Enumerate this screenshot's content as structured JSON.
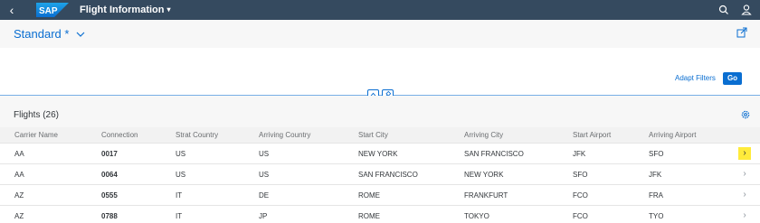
{
  "shell": {
    "logo_text": "SAP",
    "title": "Flight Information",
    "title_caret": "▾",
    "back_icon": "back-icon",
    "search_icon": "search-icon",
    "user_icon": "user-icon"
  },
  "header": {
    "variant_label": "Standard *",
    "share_icon": "share-icon"
  },
  "filterbar": {
    "adapt_filters_label": "Adapt Filters",
    "go_label": "Go"
  },
  "table": {
    "title": "Flights (26)",
    "settings_icon": "gear-icon",
    "columns": [
      "Carrier Name",
      "Connection",
      "Strat Country",
      "Arriving Country",
      "Start City",
      "Arriving City",
      "Start Airport",
      "Arriving Airport"
    ],
    "rows": [
      {
        "carrier": "AA",
        "connection": "0017",
        "start_country": "US",
        "arr_country": "US",
        "start_city": "NEW YORK",
        "arr_city": "SAN FRANCISCO",
        "start_airport": "JFK",
        "arr_airport": "SFO",
        "nav": "›"
      },
      {
        "carrier": "AA",
        "connection": "0064",
        "start_country": "US",
        "arr_country": "US",
        "start_city": "SAN FRANCISCO",
        "arr_city": "NEW YORK",
        "start_airport": "SFO",
        "arr_airport": "JFK",
        "nav": "›"
      },
      {
        "carrier": "AZ",
        "connection": "0555",
        "start_country": "IT",
        "arr_country": "DE",
        "start_city": "ROME",
        "arr_city": "FRANKFURT",
        "start_airport": "FCO",
        "arr_airport": "FRA",
        "nav": "›"
      },
      {
        "carrier": "AZ",
        "connection": "0788",
        "start_country": "IT",
        "arr_country": "JP",
        "start_city": "ROME",
        "arr_city": "TOKYO",
        "start_airport": "FCO",
        "arr_airport": "TYO",
        "nav": "›"
      }
    ]
  },
  "colors": {
    "shell_bg": "#354a5f",
    "accent": "#0a6ed1",
    "highlight": "#ffeb3b"
  }
}
